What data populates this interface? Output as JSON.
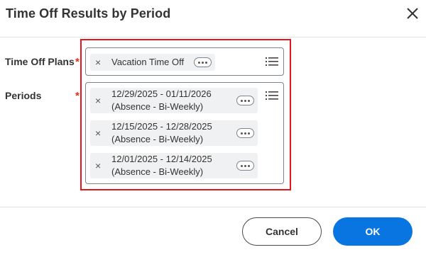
{
  "dialog": {
    "title": "Time Off Results by Period"
  },
  "fields": {
    "time_off_plans": {
      "label": "Time Off Plans",
      "required_marker": "*",
      "selected": [
        {
          "remove": "×",
          "text": "Vacation Time Off"
        }
      ]
    },
    "periods": {
      "label": "Periods",
      "required_marker": "*",
      "selected": [
        {
          "remove": "×",
          "line1": "12/29/2025 - 01/11/2026",
          "line2": "(Absence - Bi-Weekly)"
        },
        {
          "remove": "×",
          "line1": "12/15/2025 - 12/28/2025",
          "line2": "(Absence - Bi-Weekly)"
        },
        {
          "remove": "×",
          "line1": "12/01/2025 - 12/14/2025",
          "line2": "(Absence - Bi-Weekly)"
        }
      ]
    }
  },
  "buttons": {
    "cancel": "Cancel",
    "ok": "OK"
  },
  "colors": {
    "accent": "#0875e1",
    "required": "#de2e21",
    "highlight_border": "#e8141b"
  },
  "icons": {
    "close": "close-icon",
    "list": "list-icon",
    "remove": "remove-x-icon",
    "more": "more-options-icon"
  }
}
